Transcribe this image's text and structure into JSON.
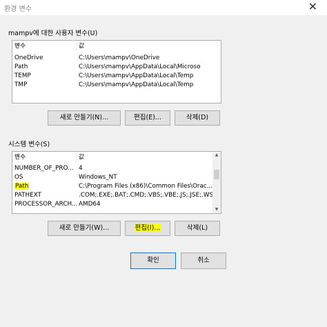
{
  "window": {
    "title": "환경 변수",
    "close_glyph": "✕"
  },
  "user_vars": {
    "group_label": "mampv에 대한 사용자 변수(U)",
    "header": {
      "name": "변수",
      "value": "값"
    },
    "rows": [
      {
        "name": "OneDrive",
        "value": "C:\\Users\\mampv\\OneDrive"
      },
      {
        "name": "Path",
        "value": "C:\\Users\\mampv\\AppData\\Local\\Microso"
      },
      {
        "name": "TEMP",
        "value": "C:\\Users\\mampv\\AppData\\Local\\Temp"
      },
      {
        "name": "TMP",
        "value": "C:\\Users\\mampv\\AppData\\Local\\Temp"
      }
    ],
    "buttons": {
      "new": "새로 만들기(N)...",
      "edit": "편집(E)...",
      "delete": "삭제(D)"
    }
  },
  "system_vars": {
    "group_label": "시스템 변수(S)",
    "header": {
      "name": "변수",
      "value": "값"
    },
    "rows": [
      {
        "name": "NUMBER_OF_PRO...",
        "value": "4"
      },
      {
        "name": "OS",
        "value": "Windows_NT"
      },
      {
        "name": "Path",
        "value": "C:\\Program Files (x86)\\Common Files\\Orac..."
      },
      {
        "name": "PATHEXT",
        "value": ".COM;.EXE;.BAT;.CMD;.VBS;.VBE;.JS;.JSE;.WSF;..."
      },
      {
        "name": "PROCESSOR_ARCH...",
        "value": "AMD64"
      }
    ],
    "buttons": {
      "new": "새로 만들기(W)...",
      "edit": "편집(I)...",
      "delete": "삭제(L)"
    }
  },
  "dialog_buttons": {
    "ok": "확인",
    "cancel": "취소"
  },
  "colors": {
    "highlight": "#ffff00",
    "focus_border": "#0078d7"
  }
}
